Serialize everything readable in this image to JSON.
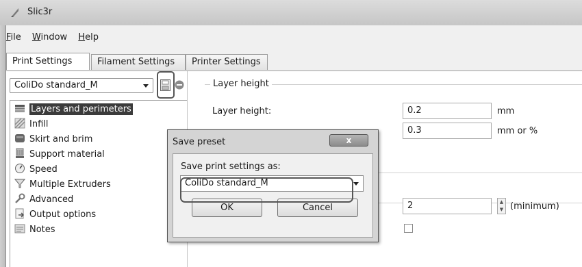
{
  "window": {
    "title": "Slic3r"
  },
  "menu": {
    "file": "File",
    "file_key": "F",
    "window": "Window",
    "window_key": "W",
    "help": "Help",
    "help_key": "H"
  },
  "tabs": {
    "print": "Print Settings",
    "filament": "Filament Settings",
    "printer": "Printer Settings"
  },
  "preset": {
    "selected": "ColiDo standard_M"
  },
  "sidebar": {
    "items": [
      {
        "label": "Layers and perimeters",
        "icon": "layers-icon"
      },
      {
        "label": "Infill",
        "icon": "infill-icon"
      },
      {
        "label": "Skirt and brim",
        "icon": "skirt-icon"
      },
      {
        "label": "Support material",
        "icon": "support-icon"
      },
      {
        "label": "Speed",
        "icon": "speed-icon"
      },
      {
        "label": "Multiple Extruders",
        "icon": "extruders-icon"
      },
      {
        "label": "Advanced",
        "icon": "wrench-icon"
      },
      {
        "label": "Output options",
        "icon": "output-icon"
      },
      {
        "label": "Notes",
        "icon": "notes-icon"
      }
    ]
  },
  "main": {
    "group_title": "Layer height",
    "layer_height_label": "Layer height:",
    "layer_height_value": "0.2",
    "layer_height_unit": "mm",
    "first_layer_value": "0.3",
    "first_layer_unit": "mm or %",
    "perimeters_value": "2",
    "perimeters_unit": "(minimum)"
  },
  "dialog": {
    "title": "Save preset",
    "close": "x",
    "prompt": "Save print settings as:",
    "name_value": "ColiDo standard_M",
    "ok": "OK",
    "cancel": "Cancel"
  }
}
